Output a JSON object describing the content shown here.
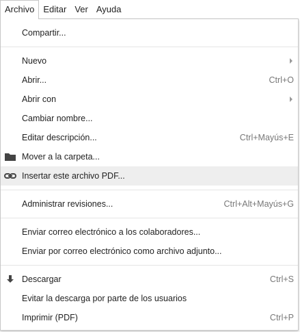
{
  "menubar": {
    "items": [
      {
        "label": "Archivo"
      },
      {
        "label": "Editar"
      },
      {
        "label": "Ver"
      },
      {
        "label": "Ayuda"
      }
    ]
  },
  "file_menu": {
    "items": [
      {
        "label": "Compartir...",
        "shortcut": ""
      },
      {
        "label": "Nuevo",
        "shortcut": ""
      },
      {
        "label": "Abrir...",
        "shortcut": "Ctrl+O"
      },
      {
        "label": "Abrir con",
        "shortcut": ""
      },
      {
        "label": "Cambiar nombre...",
        "shortcut": ""
      },
      {
        "label": "Editar descripción...",
        "shortcut": "Ctrl+Mayús+E"
      },
      {
        "label": "Mover a la carpeta...",
        "shortcut": "",
        "icon": "folder-icon"
      },
      {
        "label": "Insertar este archivo PDF...",
        "shortcut": "",
        "icon": "link-icon"
      },
      {
        "label": "Administrar revisiones...",
        "shortcut": "Ctrl+Alt+Mayús+G"
      },
      {
        "label": "Enviar correo electrónico a los colaboradores...",
        "shortcut": ""
      },
      {
        "label": "Enviar por correo electrónico como archivo adjunto...",
        "shortcut": ""
      },
      {
        "label": "Descargar",
        "shortcut": "Ctrl+S",
        "icon": "download-icon"
      },
      {
        "label": "Evitar la descarga por parte de los usuarios",
        "shortcut": ""
      },
      {
        "label": "Imprimir (PDF)",
        "shortcut": "Ctrl+P"
      }
    ]
  }
}
